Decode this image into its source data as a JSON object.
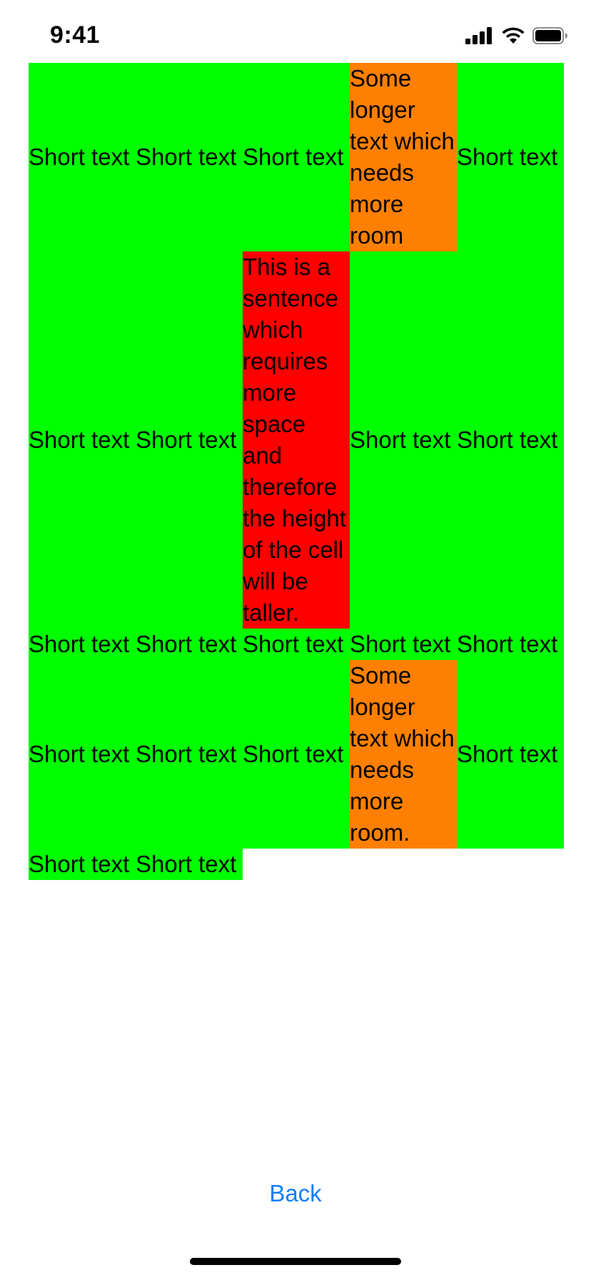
{
  "status_bar": {
    "time": "9:41"
  },
  "colors": {
    "short_cell": "#00ff00",
    "long_cell": "#ff8000",
    "longest_cell": "#ff0000",
    "link": "#147efb"
  },
  "grid": {
    "rows": [
      [
        "Short text",
        "Short text",
        "Short text",
        "Some longer text which needs more room",
        "Short text"
      ],
      [
        "Short text",
        "Short text",
        "This is a sentence which requires more space and therefore the height of the cell will be taller.",
        "Short text",
        "Short text"
      ],
      [
        "Short text",
        "Short text",
        "Short text",
        "Short text",
        "Short text"
      ],
      [
        "Short text",
        "Short text",
        "Short text",
        "Some longer text which needs more room.",
        "Short text"
      ],
      [
        "Short text",
        "Short text"
      ]
    ]
  },
  "nav": {
    "back_label": "Back"
  }
}
